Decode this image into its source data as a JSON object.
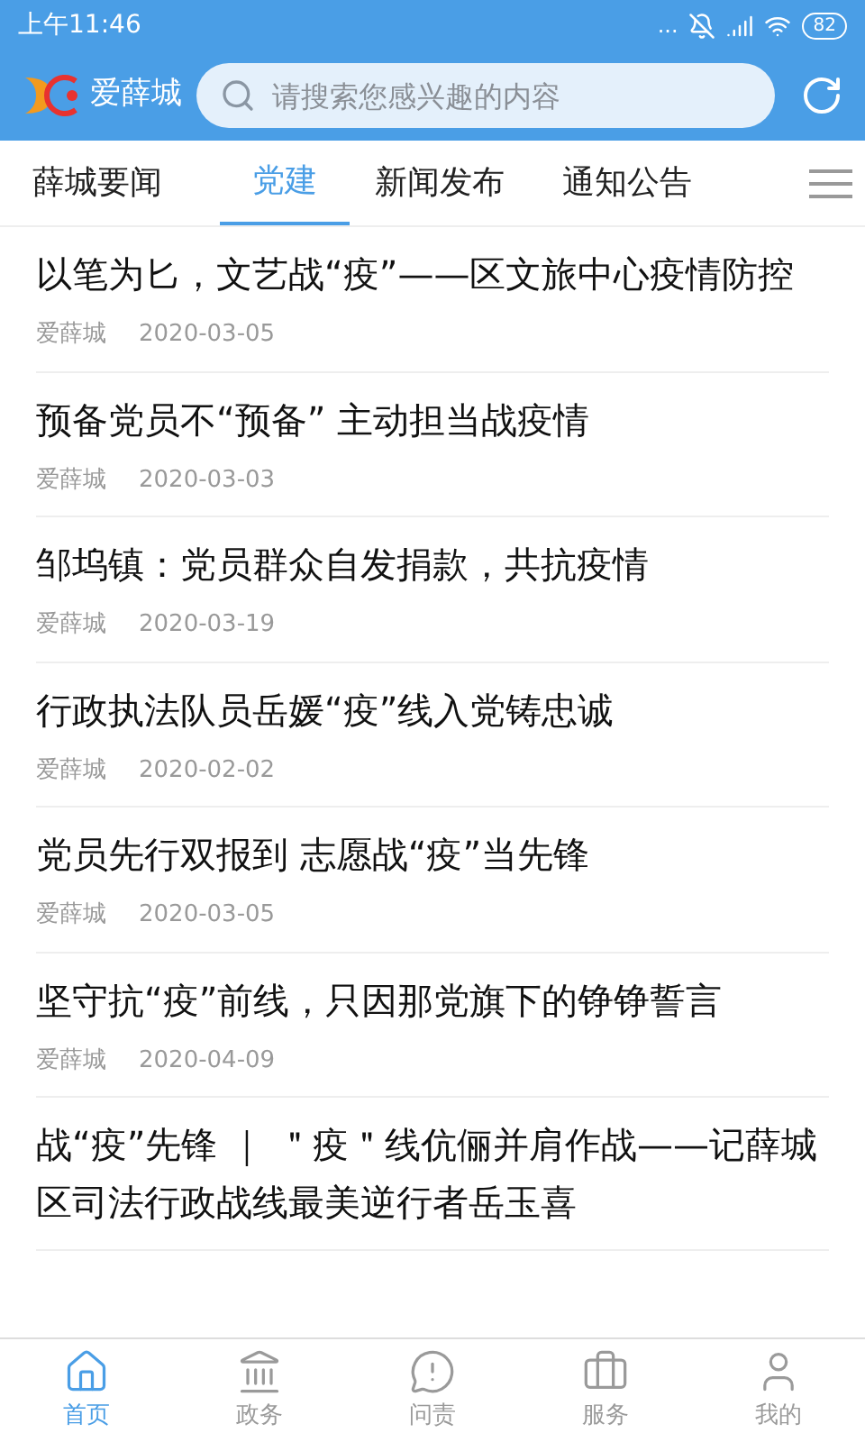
{
  "status_bar": {
    "time": "上午11:46",
    "dots": "...",
    "battery": "82"
  },
  "header": {
    "logo_text": "爱薛城",
    "search": {
      "placeholder": "请搜索您感兴趣的内容"
    }
  },
  "tabs": [
    {
      "label": "薛城要闻",
      "selected": false
    },
    {
      "label": "党建",
      "selected": true
    },
    {
      "label": "新闻发布",
      "selected": false
    },
    {
      "label": "通知公告",
      "selected": false
    }
  ],
  "articles": [
    {
      "title": "以笔为匕，文艺战“疫”——区文旅中心疫情防控",
      "source": "爱薛城",
      "date": "2020-03-05"
    },
    {
      "title": "预备党员不“预备” 主动担当战疫情",
      "source": "爱薛城",
      "date": "2020-03-03"
    },
    {
      "title": "邹坞镇：党员群众自发捐款，共抗疫情",
      "source": "爱薛城",
      "date": "2020-03-19"
    },
    {
      "title": "行政执法队员岳媛“疫”线入党铸忠诚",
      "source": "爱薛城",
      "date": "2020-02-02"
    },
    {
      "title": "党员先行双报到 志愿战“疫”当先锋",
      "source": "爱薛城",
      "date": "2020-03-05"
    },
    {
      "title": "坚守抗“疫”前线，只因那党旗下的铮铮誓言",
      "source": "爱薛城",
      "date": "2020-04-09"
    },
    {
      "title": "战“疫”先锋 ｜ ＂疫＂线伉俪并肩作战——记薛城区司法行政战线最美逆行者岳玉喜"
    }
  ],
  "bottom_nav": [
    {
      "label": "首页",
      "kind": "home",
      "selected": true
    },
    {
      "label": "政务",
      "kind": "bank",
      "selected": false
    },
    {
      "label": "问责",
      "kind": "alert",
      "selected": false
    },
    {
      "label": "服务",
      "kind": "service",
      "selected": false
    },
    {
      "label": "我的",
      "kind": "user",
      "selected": false
    }
  ]
}
